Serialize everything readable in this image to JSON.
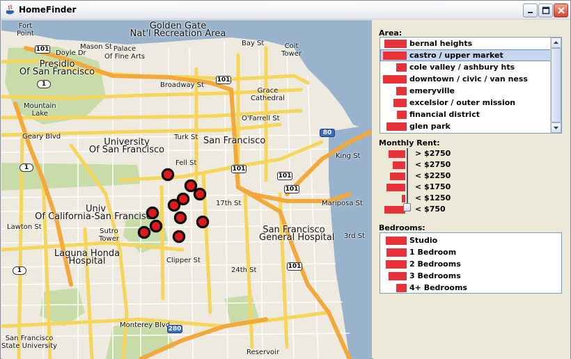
{
  "window": {
    "title": "HomeFinder"
  },
  "map": {
    "labels": {
      "fort_point": "Fort\nPoint",
      "golden_gate": "Golden Gate\nNat'l Recreation Area",
      "presidio": "Presidio\nOf San Francisco",
      "mason": "Mason St",
      "palace": "Palace\nOf Fine Arts",
      "doyle": "Doyle Dr",
      "bay_st": "Bay St",
      "coit": "Coit\nTower",
      "broadway": "Broadway St",
      "grace": "Grace\nCathedral",
      "mountain_lake": "Mountain\nLake",
      "geary": "Geary Blvd",
      "ofarrell": "O'Farrell St",
      "turk": "Turk St",
      "university": "University\nOf San Francisco",
      "san_francisco": "San Francisco",
      "fell": "Fell St",
      "univ_cal": "Univ\nOf California-San Francisco",
      "sutro": "Sutro\nTower",
      "lawton": "Lawton St",
      "laguna": "Laguna Honda\nHospital",
      "sfgh": "San Francisco\nGeneral Hospital",
      "mariposa": "Mariposa St",
      "clipper": "Clipper St",
      "monterey": "Monterey Blvd",
      "reservoir": "Reservoir",
      "sfsu": "San Francisco\nState University",
      "17th": "17th St",
      "24th": "24th St",
      "king": "King St",
      "third": "3rd St"
    },
    "shields": {
      "s101a": "101",
      "s101b": "101",
      "s101c": "101",
      "s101d": "101",
      "s101e": "101",
      "s101f": "101",
      "s1a": "1",
      "s1b": "1",
      "s1c": "1",
      "s80": "80",
      "s280": "280"
    }
  },
  "filters": {
    "area": {
      "label": "Area:",
      "items": [
        {
          "name": "bernal heights",
          "count": 0.95
        },
        {
          "name": "castro / upper market",
          "count": 1.0,
          "selected": true
        },
        {
          "name": "cole valley / ashbury hts",
          "count": 0.45
        },
        {
          "name": "downtown / civic / van ness",
          "count": 1.0
        },
        {
          "name": "emeryville",
          "count": 0.45
        },
        {
          "name": "excelsior / outer mission",
          "count": 0.55
        },
        {
          "name": "financial district",
          "count": 0.4
        },
        {
          "name": "glen park",
          "count": 0.85
        }
      ]
    },
    "rent": {
      "label": "Monthly Rent:",
      "items": [
        {
          "name": "> $2750",
          "count": 0.75
        },
        {
          "name": "< $2750",
          "count": 0.55
        },
        {
          "name": "< $2250",
          "count": 0.7
        },
        {
          "name": "< $1750",
          "count": 0.85
        },
        {
          "name": "< $1250",
          "count": 0.15
        },
        {
          "name": "< $750",
          "count": 0.95
        }
      ]
    },
    "bedrooms": {
      "label": "Bedrooms:",
      "items": [
        {
          "name": "Studio",
          "count": 0.88
        },
        {
          "name": "1 Bedroom",
          "count": 0.85
        },
        {
          "name": "2 Bedrooms",
          "count": 0.88
        },
        {
          "name": "3 Bedrooms",
          "count": 0.75
        },
        {
          "name": "4+ Bedrooms",
          "count": 0.45
        }
      ]
    }
  },
  "colors": {
    "bar": "#e8323a",
    "marker": "#e01a1a",
    "selection": "#c5d6ee"
  }
}
